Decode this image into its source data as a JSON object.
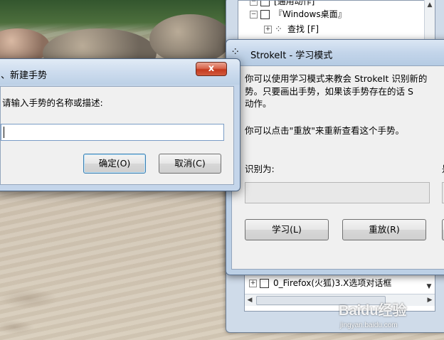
{
  "gesture_tree": {
    "rows": [
      {
        "label": "[通用动作]"
      },
      {
        "label": "『Windows桌面』"
      },
      {
        "label": "查找 [F]"
      }
    ],
    "bottom_row": {
      "label": "0_Firefox(火狐)3.X选项对话框"
    }
  },
  "learn_window": {
    "title": "StrokeIt - 学习模式",
    "para1_line1": "你可以使用学习模式来教会 StrokeIt 识别新的",
    "para1_line2": "势。只要画出手势，如果该手势存在的话 S",
    "para1_line3": "动作。",
    "para2": "你可以点击\"重放\"来重新查看这个手势。",
    "recognized_label": "识别为:",
    "recognized_value": "",
    "side_label_fragment": "是",
    "learn_button": "学习(L)",
    "replay_button": "重放(R)"
  },
  "new_gesture_dialog": {
    "title": "、新建手势",
    "close_glyph": "x",
    "prompt": "请输入手势的名称或描述:",
    "input_value": "",
    "ok_button": "确定(O)",
    "cancel_button": "取消(C)"
  },
  "watermark": {
    "logo": "Baidu经验",
    "url": "jingyan.baidu.com"
  },
  "icons": {
    "tree_expand": "plus-box-icon",
    "gesture_node": "gesture-node-icon",
    "strokeit_app": "strokeit-sparkle-icon"
  }
}
